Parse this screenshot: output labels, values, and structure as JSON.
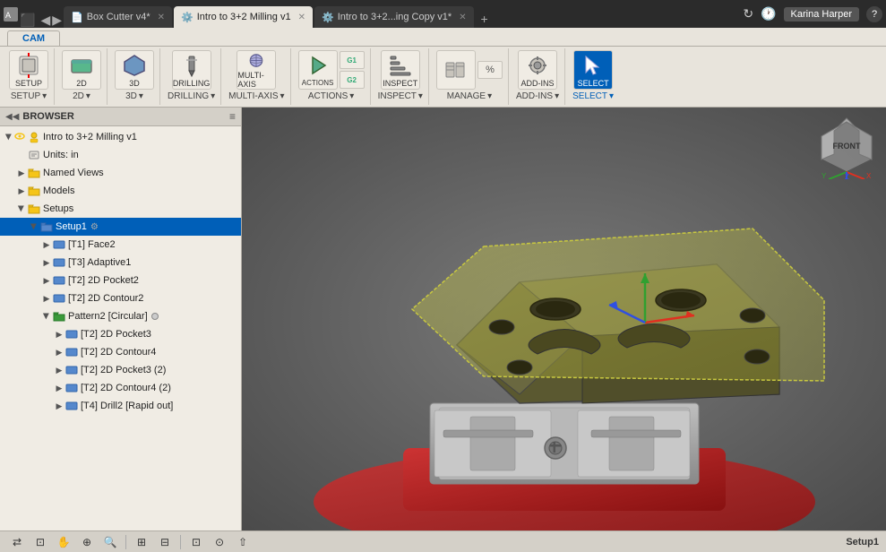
{
  "titlebar": {
    "tabs": [
      {
        "label": "Box Cutter v4*",
        "active": false,
        "icon": "📄"
      },
      {
        "label": "Intro to 3+2 Milling v1",
        "active": true,
        "icon": "⚙️"
      },
      {
        "label": "Intro to 3+2...ing Copy v1*",
        "active": false,
        "icon": "⚙️"
      }
    ],
    "new_tab": "+",
    "nav_back": "◀",
    "nav_forward": "▶",
    "clock": "🕐",
    "user": "Karina Harper",
    "help": "?"
  },
  "toolbar": {
    "cam_tab": "CAM",
    "groups": [
      {
        "label": "SETUP",
        "buttons": [
          {
            "icon": "📋",
            "label": "SETUP",
            "large": true
          },
          {
            "icon": "🔧",
            "label": "",
            "small": true
          }
        ]
      },
      {
        "label": "2D",
        "buttons": [
          {
            "icon": "◻",
            "label": "2D"
          }
        ]
      },
      {
        "label": "3D",
        "buttons": [
          {
            "icon": "◼",
            "label": "3D"
          }
        ]
      },
      {
        "label": "DRILLING",
        "buttons": [
          {
            "icon": "⬇",
            "label": "DRILLING"
          }
        ]
      },
      {
        "label": "MULTI-AXIS",
        "buttons": [
          {
            "icon": "✦",
            "label": "MULTI-AXIS"
          }
        ]
      },
      {
        "label": "ACTIONS",
        "buttons": [
          {
            "icon": "▶",
            "label": "ACTIONS"
          },
          {
            "icon": "G1G2",
            "label": ""
          }
        ]
      },
      {
        "label": "INSPECT",
        "buttons": [
          {
            "icon": "📏",
            "label": "INSPECT"
          }
        ]
      },
      {
        "label": "MANAGE",
        "buttons": [
          {
            "icon": "🔲",
            "label": "MANAGE"
          },
          {
            "icon": "%",
            "label": ""
          }
        ]
      },
      {
        "label": "ADD-INS",
        "buttons": [
          {
            "icon": "⚙",
            "label": "ADD-INS"
          }
        ]
      },
      {
        "label": "SELECT",
        "buttons": [
          {
            "icon": "↖",
            "label": "SELECT"
          }
        ]
      }
    ]
  },
  "browser": {
    "title": "BROWSER",
    "collapse_icon": "◀◀",
    "menu_icon": "≡"
  },
  "tree": {
    "items": [
      {
        "id": "root",
        "label": "Intro to 3+2 Milling v1",
        "indent": 0,
        "expanded": true,
        "icon": "👁",
        "type": "root"
      },
      {
        "id": "units",
        "label": "Units: in",
        "indent": 1,
        "expanded": false,
        "icon": "📄",
        "type": "info"
      },
      {
        "id": "named-views",
        "label": "Named Views",
        "indent": 1,
        "expanded": false,
        "icon": "📁",
        "type": "folder"
      },
      {
        "id": "models",
        "label": "Models",
        "indent": 1,
        "expanded": false,
        "icon": "👁",
        "type": "folder"
      },
      {
        "id": "setups",
        "label": "Setups",
        "indent": 1,
        "expanded": true,
        "icon": "📁",
        "type": "folder"
      },
      {
        "id": "setup1",
        "label": "Setup1",
        "indent": 2,
        "expanded": true,
        "icon": "📁",
        "type": "setup",
        "selected": true,
        "has_gear": true
      },
      {
        "id": "face2",
        "label": "[T1] Face2",
        "indent": 3,
        "expanded": false,
        "icon": "▶",
        "type": "op"
      },
      {
        "id": "adaptive1",
        "label": "[T3] Adaptive1",
        "indent": 3,
        "expanded": false,
        "icon": "▶",
        "type": "op"
      },
      {
        "id": "pocket2",
        "label": "[T2] 2D Pocket2",
        "indent": 3,
        "expanded": false,
        "icon": "▶",
        "type": "op"
      },
      {
        "id": "contour2",
        "label": "[T2] 2D Contour2",
        "indent": 3,
        "expanded": false,
        "icon": "▶",
        "type": "op"
      },
      {
        "id": "pattern2",
        "label": "Pattern2 [Circular]",
        "indent": 3,
        "expanded": true,
        "icon": "📁",
        "type": "pattern",
        "has_circle": true
      },
      {
        "id": "pocket3",
        "label": "[T2] 2D Pocket3",
        "indent": 4,
        "expanded": false,
        "icon": "▶",
        "type": "op"
      },
      {
        "id": "contour4",
        "label": "[T2] 2D Contour4",
        "indent": 4,
        "expanded": false,
        "icon": "▶",
        "type": "op"
      },
      {
        "id": "pocket3-2",
        "label": "[T2] 2D Pocket3 (2)",
        "indent": 4,
        "expanded": false,
        "icon": "▶",
        "type": "op"
      },
      {
        "id": "contour4-2",
        "label": "[T2] 2D Contour4 (2)",
        "indent": 4,
        "expanded": false,
        "icon": "▶",
        "type": "op"
      },
      {
        "id": "drill2",
        "label": "[T4] Drill2 [Rapid out]",
        "indent": 4,
        "expanded": false,
        "icon": "▶",
        "type": "op"
      }
    ]
  },
  "statusbar": {
    "tools": [
      "⇄",
      "⊡",
      "✋",
      "⊕+",
      "🔍",
      "|",
      "⊞",
      "⊟",
      "|",
      "⊡",
      "⊙"
    ],
    "status": "Setup1"
  }
}
